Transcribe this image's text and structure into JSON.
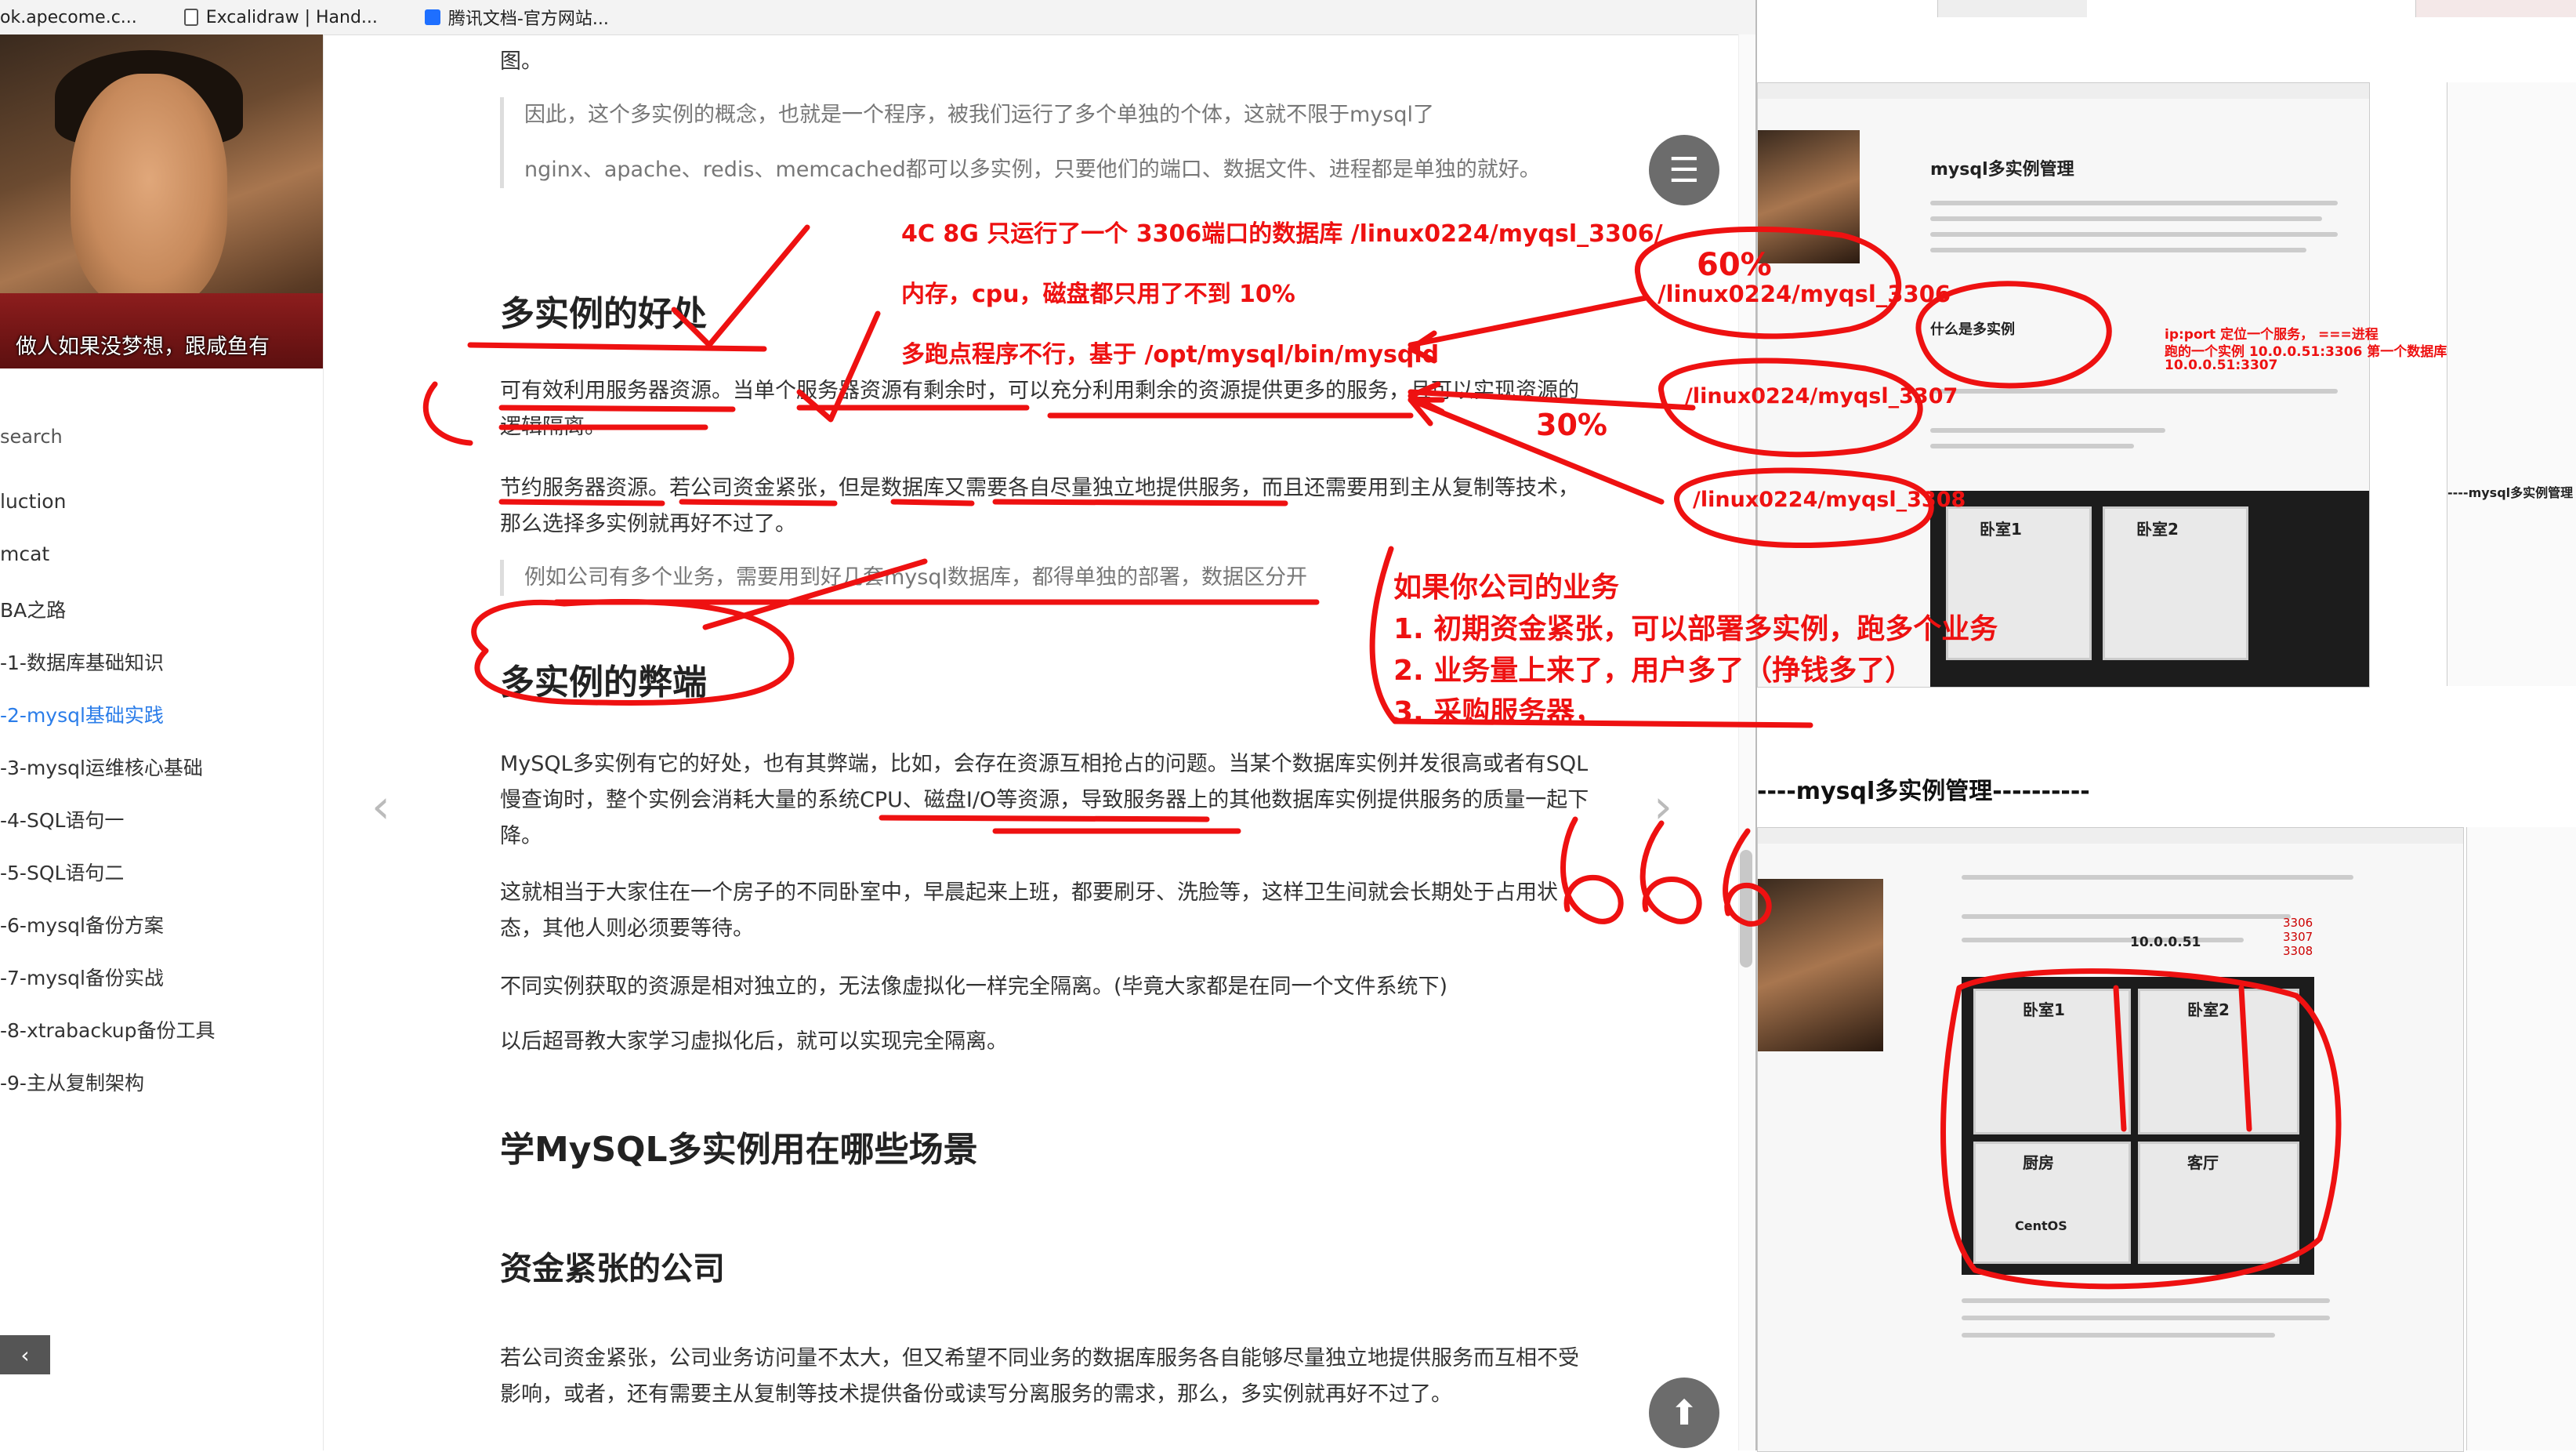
{
  "bookmarks": [
    {
      "label": "ok.apecome.c...",
      "icon": "page-icon"
    },
    {
      "label": "Excalidraw | Hand...",
      "icon": "document-icon"
    },
    {
      "label": "腾讯文档-官方网站...",
      "icon": "tencent-icon"
    }
  ],
  "sidebar": {
    "avatar_caption": "做人如果没梦想，跟咸鱼有",
    "search_label": "search",
    "nav": [
      "luction",
      "mcat",
      "BA之路",
      "-1-数据库基础知识",
      "-2-mysql基础实践",
      "-3-mysql运维核心基础",
      "-4-SQL语句一",
      "-5-SQL语句二",
      "-6-mysql备份方案",
      "-7-mysql备份实战",
      "-8-xtrabackup备份工具",
      "-9-主从复制架构"
    ],
    "active_index": 4,
    "collapse_glyph": "‹"
  },
  "article": {
    "intro_fragment": "图。",
    "quote1_a": "因此，这个多实例的概念，也就是一个程序，被我们运行了多个单独的个体，这就不限于mysql了",
    "quote1_b": "nginx、apache、redis、memcached都可以多实例，只要他们的端口、数据文件、进程都是单独的就好。",
    "h_advantages": "多实例的好处",
    "adv_p1": "可有效利用服务器资源。当单个服务器资源有剩余时，可以充分利用剩余的资源提供更多的服务，且可以实现资源的逻辑隔离。",
    "adv_p2": "节约服务器资源。若公司资金紧张，但是数据库又需要各自尽量独立地提供服务，而且还需要用到主从复制等技术，那么选择多实例就再好不过了。",
    "quote2": "例如公司有多个业务，需要用到好几套mysql数据库，都得单独的部署，数据区分开",
    "h_disadvantages": "多实例的弊端",
    "dis_p1": "MySQL多实例有它的好处，也有其弊端，比如，会存在资源互相抢占的问题。当某个数据库实例并发很高或者有SQL慢查询时，整个实例会消耗大量的系统CPU、磁盘I/O等资源，导致服务器上的其他数据库实例提供服务的质量一起下降。",
    "dis_p2": "这就相当于大家住在一个房子的不同卧室中，早晨起来上班，都要刷牙、洗脸等，这样卫生间就会长期处于占用状态，其他人则必须要等待。",
    "dis_p3": "不同实例获取的资源是相对独立的，无法像虚拟化一样完全隔离。(毕竟大家都是在同一个文件系统下)",
    "dis_p4": "以后超哥教大家学习虚拟化后，就可以实现完全隔离。",
    "h_scenarios": "学MySQL多实例用在哪些场景",
    "h_low_budget": "资金紧张的公司",
    "budget_p": "若公司资金紧张，公司业务访问量不太大，但又希望不同业务的数据库服务各自能够尽量独立地提供服务而互相不受影响，或者，还有需要主从复制等技术提供备份或读写分离服务的需求，那么，多实例就再好不过了。",
    "menu_glyph": "☰",
    "up_glyph": "⬆",
    "prev_glyph": "‹",
    "next_glyph": "›"
  },
  "annotations": {
    "line1": "4C  8G  只运行了一个 3306端口的数据库 /linux0224/myqsl_3306/",
    "line2": "内存，cpu，磁盘都只用了不到 10%",
    "line3": "多跑点程序不行，基于 /opt/mysql/bin/mysqld",
    "pct60": "60%",
    "path3306": "/linux0224/myqsl_3306",
    "path3307": "/linux0224/myqsl_3307",
    "pct30": "30%",
    "path3308": "/linux0224/myqsl_3308",
    "biz_title": "如果你公司的业务",
    "biz1": "1. 初期资金紧张，可以部署多实例，跑多个业务",
    "biz2": "2. 业务量上来了，用户多了（挣钱多了）",
    "biz3": "3. 采购服务器，",
    "scribble666": "666",
    "ipport_1": "ip:port 定位一个服务， ===进程",
    "ipport_2": "跑的一个实例 10.0.0.51:3306 第一个数据库",
    "ipport_3": "10.0.0.51:3307"
  },
  "right_panel": {
    "thumb1_title": "mysql多实例管理",
    "thumb1_subtitle": "什么是多实例",
    "room1": "卧室1",
    "room2": "卧室2",
    "room3": "厨房",
    "room4": "客厅",
    "os_label": "CentOS",
    "dash_title": "----mysql多实例管理----------",
    "edge_label": "----mysql多实例管理",
    "mini_ip": "10.0.0.51",
    "mini_ports": [
      "3306",
      "3307",
      "3308"
    ]
  }
}
